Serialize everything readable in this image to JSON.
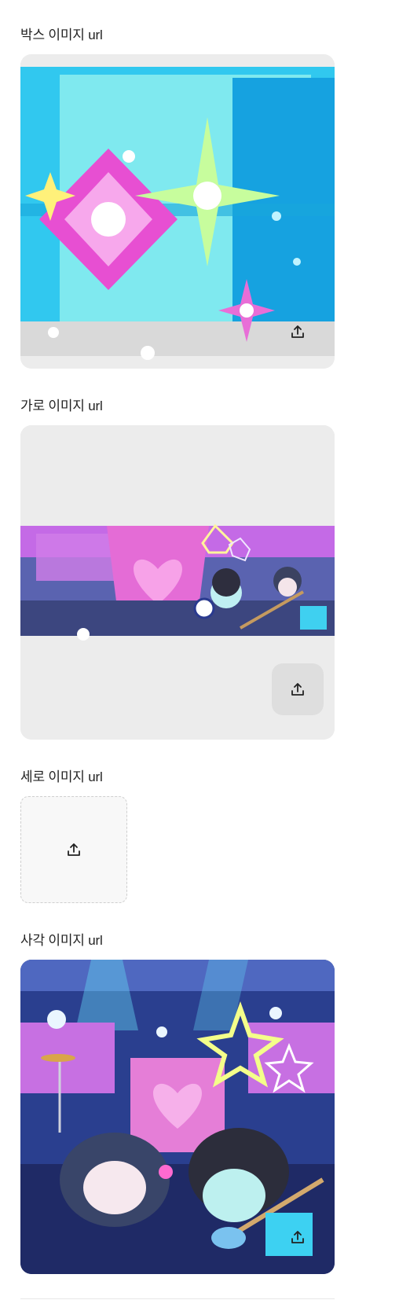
{
  "fields": {
    "box": {
      "label": "박스 이미지 url",
      "image_alt": "box image: pixel sparkles on cyan"
    },
    "horizontal": {
      "label": "가로 이미지 url",
      "image_alt": "horizontal image: pixel stage banner"
    },
    "vertical": {
      "label": "세로 이미지 url"
    },
    "square": {
      "label": "사각 이미지 url",
      "image_alt": "square image: pixel band characters on stage"
    }
  },
  "icons": {
    "upload": "upload-icon"
  },
  "colors": {
    "frame_bg": "#ececec",
    "dropzone_border": "#cfcfcf",
    "text": "#222222"
  }
}
